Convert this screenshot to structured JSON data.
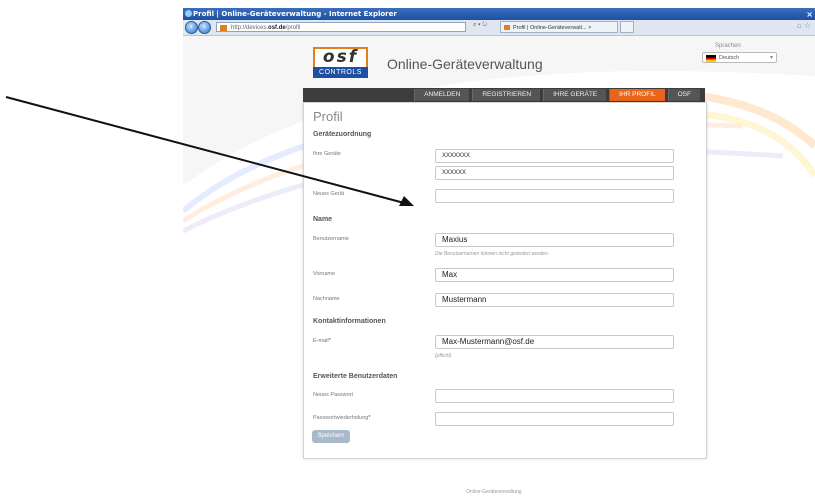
{
  "browser": {
    "window_title": "Profil | Online-Geräteverwaltung - Internet Explorer",
    "address_prefix": "http://devices.",
    "address_domain": "osf.de",
    "address_path": "/profil",
    "tab_title": "Profil | Online-Geräteverwalt... ×",
    "search_tools": "⌕ ▾ ↻"
  },
  "header": {
    "logo_text": "osf",
    "logo_subtext": "CONTROLS",
    "app_title": "Online-Geräteverwaltung",
    "language_label": "Sprachen",
    "language_value": "Deutsch"
  },
  "nav": {
    "items": [
      "ANMELDEN",
      "REGISTRIEREN",
      "IHRE GERÄTE",
      "IHR PROFIL",
      "OSF"
    ],
    "active": "IHR PROFIL"
  },
  "form": {
    "title": "Profil",
    "sections": {
      "assignment": "Gerätezuordnung",
      "name": "Name",
      "contact": "Kontaktinformationen",
      "advanced": "Erweiterte Benutzerdaten"
    },
    "labels": {
      "devices": "Ihre Geräte",
      "new_device": "Neues Gerät",
      "username": "Benutzername",
      "firstname": "Vorname",
      "lastname": "Nachname",
      "email": "E-mail",
      "new_password": "Neues Passwort",
      "password_repeat": "Passwortwiederholung"
    },
    "values": {
      "device_1": "XXXXXXX",
      "device_2": "XXXXXX",
      "new_device": "",
      "username": "Maxius",
      "firstname": "Max",
      "lastname": "Mustermann",
      "email": "Max-Mustermann@osf.de",
      "new_password": "",
      "password_repeat": ""
    },
    "hints": {
      "username": "Die Benutzernamen können nicht geändert werden",
      "email": "(pflicht)"
    },
    "required_marker": "*",
    "save_label": "Speichern"
  },
  "footer": {
    "text": "Online-Geräteverwaltung"
  },
  "colors": {
    "accent_orange": "#e8651b",
    "brand_blue": "#1e4fa0",
    "nav_bg": "#3d3d3d"
  }
}
